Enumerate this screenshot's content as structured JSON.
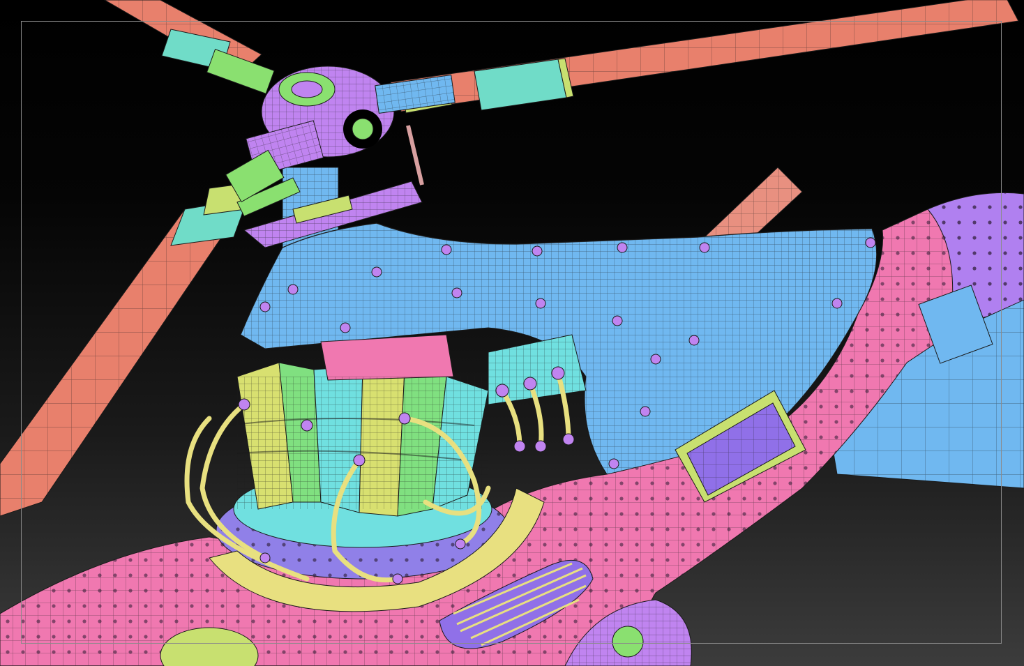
{
  "viewport": {
    "background_top": "#000000",
    "background_bottom": "#3c3c3c",
    "frame_color": "#8a8a8a"
  },
  "palette": {
    "rotor_blade": "#e8806c",
    "blade_tip": "#70dcc8",
    "blade_cuff": "#c8e070",
    "rotor_hub": "#c084f0",
    "hub_accent": "#8ae070",
    "engine_cowl": "#70b8f0",
    "fuselage": "#f078b0",
    "boom_fairing": "#b080f0",
    "cylinder_yellow": "#d8e070",
    "cylinder_green": "#80e080",
    "cylinder_cyan": "#70e0e0",
    "exhaust_pipe": "#e8e080",
    "exhaust_stack": "#e89080",
    "engine_base_ring": "#9080e8",
    "access_panel": "#9070e8",
    "rivet": "#2a1a30",
    "wireframe_line": "#1a1a1a"
  }
}
